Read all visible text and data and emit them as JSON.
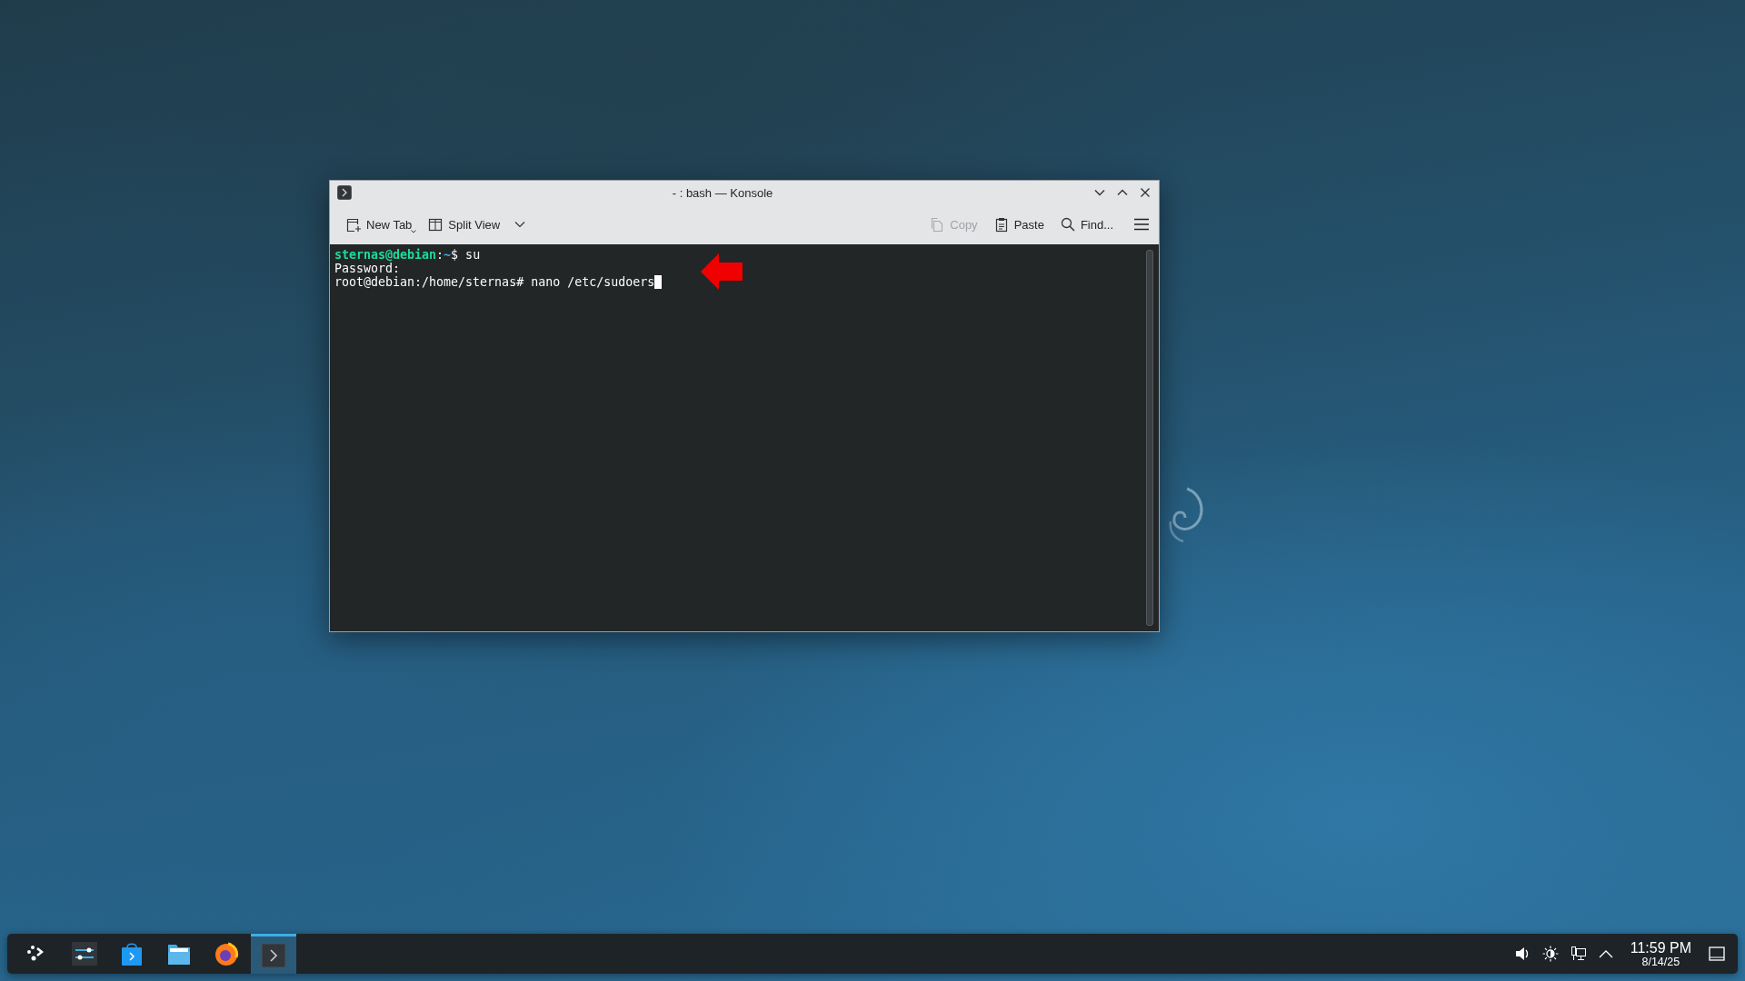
{
  "window": {
    "title": "- : bash — Konsole",
    "toolbar_left": [
      {
        "kind": "new-tab",
        "label": "New Tab",
        "disabled": false
      },
      {
        "kind": "split-view",
        "label": "Split View",
        "disabled": false
      }
    ],
    "toolbar_right": [
      {
        "kind": "copy",
        "label": "Copy",
        "disabled": true
      },
      {
        "kind": "paste",
        "label": "Paste",
        "disabled": false
      },
      {
        "kind": "find",
        "label": "Find...",
        "disabled": false
      }
    ],
    "terminal": {
      "lines": [
        {
          "segments": [
            {
              "kind": "user",
              "text": "sternas@debian"
            },
            {
              "kind": "plain",
              "text": ":"
            },
            {
              "kind": "path",
              "text": "~"
            },
            {
              "kind": "plain",
              "text": "$ su"
            }
          ],
          "cursor": false
        },
        {
          "segments": [
            {
              "kind": "plain",
              "text": "Password:"
            }
          ],
          "cursor": false
        },
        {
          "segments": [
            {
              "kind": "plain",
              "text": "root@debian:/home/sternas# nano /etc/sudoers"
            }
          ],
          "cursor": true
        }
      ]
    }
  },
  "taskbar": {
    "apps": [
      {
        "kind": "launcher",
        "selected": false
      },
      {
        "kind": "settings",
        "selected": false
      },
      {
        "kind": "store",
        "selected": false
      },
      {
        "kind": "files",
        "selected": false
      },
      {
        "kind": "browser",
        "selected": false
      },
      {
        "kind": "terminal",
        "selected": true
      }
    ],
    "clock": {
      "time": "11:59 PM",
      "date": "8/14/25"
    }
  }
}
